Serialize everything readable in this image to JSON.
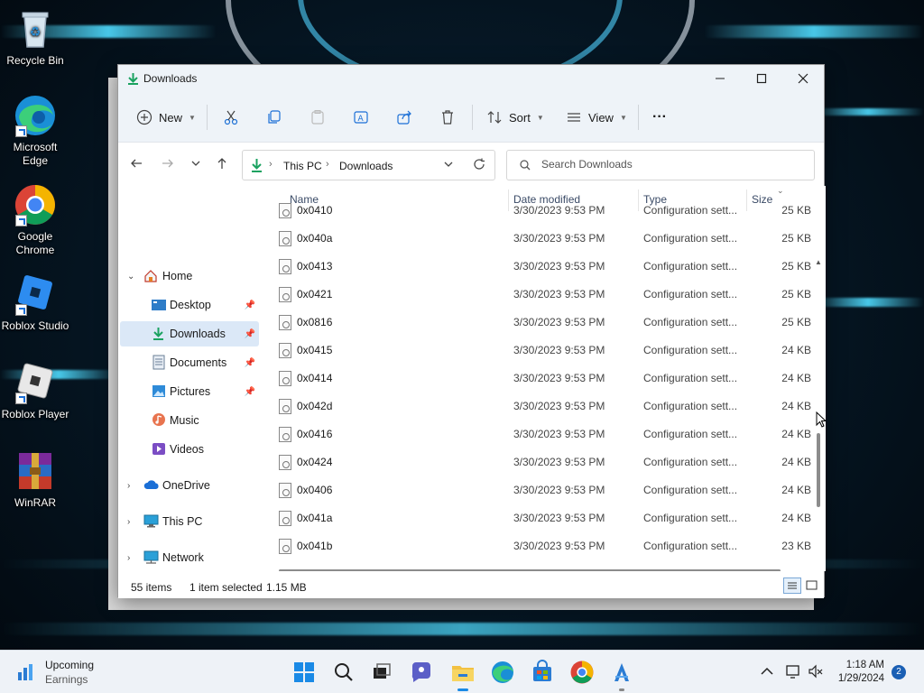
{
  "desktop": {
    "icons": [
      {
        "label": "Recycle Bin"
      },
      {
        "label": "Microsoft Edge"
      },
      {
        "label": "Google Chrome"
      },
      {
        "label": "Roblox Studio"
      },
      {
        "label": "Roblox Player"
      },
      {
        "label": "WinRAR"
      }
    ]
  },
  "window": {
    "title": "Downloads",
    "toolbar": {
      "new_label": "New",
      "sort_label": "Sort",
      "view_label": "View",
      "more_label": "···"
    },
    "address": {
      "segments": [
        "This PC",
        "Downloads"
      ]
    },
    "search": {
      "placeholder": "Search Downloads"
    },
    "sidebar": {
      "items": [
        {
          "label": "Home"
        },
        {
          "label": "Desktop"
        },
        {
          "label": "Downloads"
        },
        {
          "label": "Documents"
        },
        {
          "label": "Pictures"
        },
        {
          "label": "Music"
        },
        {
          "label": "Videos"
        },
        {
          "label": "OneDrive"
        },
        {
          "label": "This PC"
        },
        {
          "label": "Network"
        }
      ]
    },
    "columns": {
      "name": "Name",
      "date": "Date modified",
      "type": "Type",
      "size": "Size"
    },
    "files": [
      {
        "name": "0x0410",
        "date": "3/30/2023 9:53 PM",
        "type": "Configuration sett...",
        "size": "25 KB"
      },
      {
        "name": "0x040a",
        "date": "3/30/2023 9:53 PM",
        "type": "Configuration sett...",
        "size": "25 KB"
      },
      {
        "name": "0x0413",
        "date": "3/30/2023 9:53 PM",
        "type": "Configuration sett...",
        "size": "25 KB"
      },
      {
        "name": "0x0421",
        "date": "3/30/2023 9:53 PM",
        "type": "Configuration sett...",
        "size": "25 KB"
      },
      {
        "name": "0x0816",
        "date": "3/30/2023 9:53 PM",
        "type": "Configuration sett...",
        "size": "25 KB"
      },
      {
        "name": "0x0415",
        "date": "3/30/2023 9:53 PM",
        "type": "Configuration sett...",
        "size": "24 KB"
      },
      {
        "name": "0x0414",
        "date": "3/30/2023 9:53 PM",
        "type": "Configuration sett...",
        "size": "24 KB"
      },
      {
        "name": "0x042d",
        "date": "3/30/2023 9:53 PM",
        "type": "Configuration sett...",
        "size": "24 KB"
      },
      {
        "name": "0x0416",
        "date": "3/30/2023 9:53 PM",
        "type": "Configuration sett...",
        "size": "24 KB"
      },
      {
        "name": "0x0424",
        "date": "3/30/2023 9:53 PM",
        "type": "Configuration sett...",
        "size": "24 KB"
      },
      {
        "name": "0x0406",
        "date": "3/30/2023 9:53 PM",
        "type": "Configuration sett...",
        "size": "24 KB"
      },
      {
        "name": "0x041a",
        "date": "3/30/2023 9:53 PM",
        "type": "Configuration sett...",
        "size": "24 KB"
      },
      {
        "name": "0x041b",
        "date": "3/30/2023 9:53 PM",
        "type": "Configuration sett...",
        "size": "23 KB"
      }
    ],
    "status": {
      "items_count": "55 items",
      "selection": "1 item selected",
      "selection_size": "1.15 MB"
    }
  },
  "taskbar": {
    "widget": {
      "title": "Upcoming",
      "subtitle": "Earnings"
    },
    "time": "1:18 AM",
    "date": "1/29/2024",
    "notification_count": "2"
  },
  "colors": {
    "accent": "#0067c0",
    "selected_bg": "#dbe8f7",
    "titlebar_bg": "#eef3f8"
  }
}
